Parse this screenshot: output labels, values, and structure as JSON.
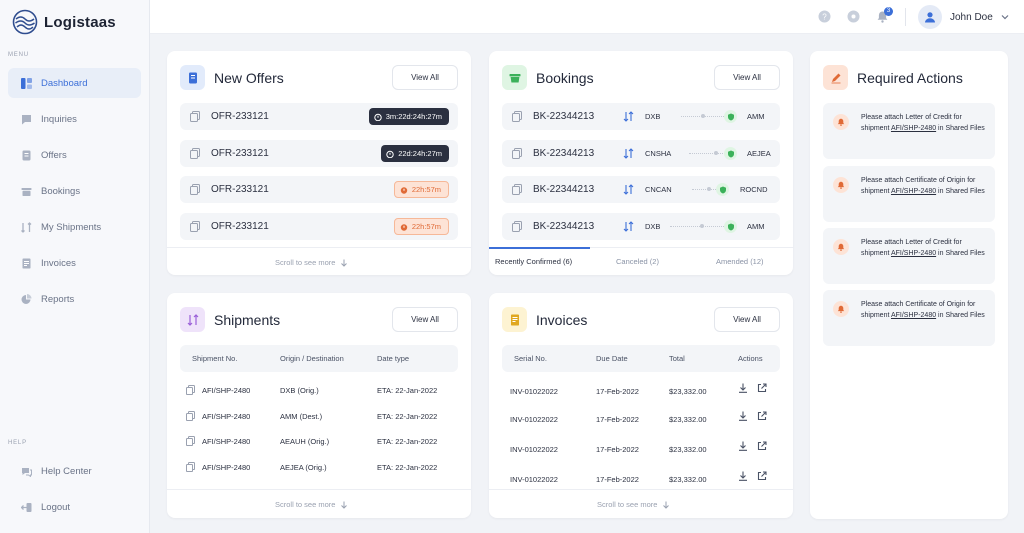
{
  "app": {
    "name": "Logistaas"
  },
  "sidebar": {
    "menu_label": "MENU",
    "help_label": "HELP",
    "items": [
      {
        "label": "Dashboard",
        "icon": "dashboard-icon",
        "active": true
      },
      {
        "label": "Inquiries",
        "icon": "inquiries-icon"
      },
      {
        "label": "Offers",
        "icon": "offers-icon"
      },
      {
        "label": "Bookings",
        "icon": "bookings-icon"
      },
      {
        "label": "My Shipments",
        "icon": "shipments-icon"
      },
      {
        "label": "Invoices",
        "icon": "invoices-icon"
      },
      {
        "label": "Reports",
        "icon": "reports-icon"
      }
    ],
    "help_items": [
      {
        "label": "Help Center",
        "icon": "help-center-icon"
      },
      {
        "label": "Logout",
        "icon": "logout-icon"
      }
    ]
  },
  "topbar": {
    "notifications_count": "3",
    "user_name": "John Doe"
  },
  "new_offers": {
    "title": "New Offers",
    "view_all": "View All",
    "rows": [
      {
        "id": "OFR-233121",
        "timer": "3m:22d:24h:27m",
        "status": "normal"
      },
      {
        "id": "OFR-233121",
        "timer": "22d:24h:27m",
        "status": "normal"
      },
      {
        "id": "OFR-233121",
        "timer": "22h:57m",
        "status": "warning"
      },
      {
        "id": "OFR-233121",
        "timer": "22h:57m",
        "status": "warning"
      }
    ],
    "scroll_hint": "Scroll to see more"
  },
  "bookings": {
    "title": "Bookings",
    "view_all": "View All",
    "rows": [
      {
        "id": "BK-22344213",
        "from": "DXB",
        "to": "AMM"
      },
      {
        "id": "BK-22344213",
        "from": "CNSHA",
        "to": "AEJEA"
      },
      {
        "id": "BK-22344213",
        "from": "CNCAN",
        "to": "ROCND"
      },
      {
        "id": "BK-22344213",
        "from": "DXB",
        "to": "AMM"
      }
    ],
    "tabs": [
      {
        "label": "Recently Confirmed (6)",
        "active": true
      },
      {
        "label": "Canceled (2)"
      },
      {
        "label": "Amended (12)"
      }
    ]
  },
  "required_actions": {
    "title": "Required Actions",
    "items": [
      {
        "prefix": "Please attach Letter of Credit for shipment ",
        "shipment": "AFI/SHP-2480",
        "suffix": " in Shared Files"
      },
      {
        "prefix": "Please attach Certificate of Origin for shipment ",
        "shipment": "AFI/SHP-2480",
        "suffix": " in Shared Files"
      },
      {
        "prefix": "Please attach Letter of Credit for shipment ",
        "shipment": "AFI/SHP-2480",
        "suffix": " in Shared Files"
      },
      {
        "prefix": "Please attach Certificate of Origin for shipment ",
        "shipment": "AFI/SHP-2480",
        "suffix": " in Shared Files"
      }
    ]
  },
  "shipments": {
    "title": "Shipments",
    "view_all": "View All",
    "columns": [
      "Shipment No.",
      "Origin / Destination",
      "Date type"
    ],
    "rows": [
      {
        "no": "AFI/SHP-2480",
        "place": "DXB (Orig.)",
        "date": "ETA: 22-Jan-2022"
      },
      {
        "no": "AFI/SHP-2480",
        "place": "AMM (Dest.)",
        "date": "ETA: 22-Jan-2022"
      },
      {
        "no": "AFI/SHP-2480",
        "place": "AEAUH (Orig.)",
        "date": "ETA: 22-Jan-2022"
      },
      {
        "no": "AFI/SHP-2480",
        "place": "AEJEA (Orig.)",
        "date": "ETA: 22-Jan-2022"
      }
    ],
    "scroll_hint": "Scroll to see more"
  },
  "invoices": {
    "title": "Invoices",
    "view_all": "View All",
    "columns": [
      "Serial No.",
      "Due Date",
      "Total",
      "Actions"
    ],
    "rows": [
      {
        "serial": "INV-01022022",
        "due": "17-Feb-2022",
        "total": "$23,332.00"
      },
      {
        "serial": "INV-01022022",
        "due": "17-Feb-2022",
        "total": "$23,332.00"
      },
      {
        "serial": "INV-01022022",
        "due": "17-Feb-2022",
        "total": "$23,332.00"
      },
      {
        "serial": "INV-01022022",
        "due": "17-Feb-2022",
        "total": "$23,332.00"
      }
    ],
    "scroll_hint": "Scroll to see more"
  },
  "colors": {
    "accent": "#3c6fd8",
    "warning": "#e06a36",
    "success": "#3bb15a",
    "background": "#f1f3f7"
  }
}
